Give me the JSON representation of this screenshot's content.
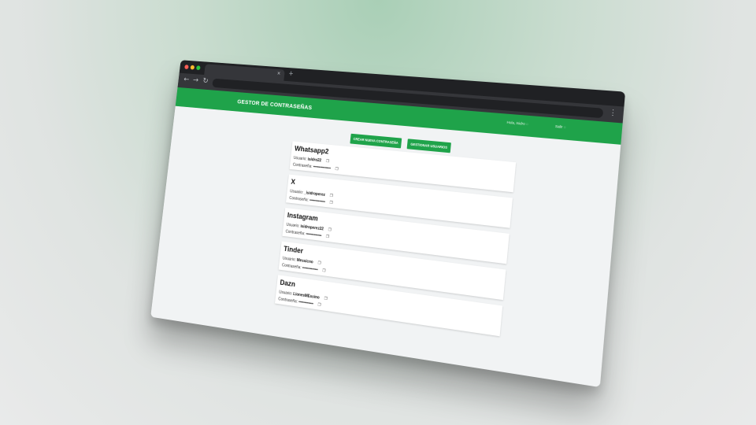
{
  "browser": {
    "tab_close": "×",
    "new_tab": "+",
    "back": "←",
    "forward": "→",
    "reload": "↻",
    "menu": "⋮"
  },
  "app": {
    "brand": "GESTOR DE CONTRASEÑAS",
    "greeting": "Hola, Isidro",
    "logout": "Salir",
    "create_button": "CREAR NUEVA CONTRASEÑA",
    "manage_button": "GESTIONAR USUARIOS"
  },
  "entries": [
    {
      "title": "Whatsapp2",
      "user_label": "Usuario:",
      "user": "isidro22",
      "pass_label": "Contraseña:",
      "pass": "••••••••••••••••••"
    },
    {
      "title": "X",
      "user_label": "Usuario:",
      "user": "_isidroperez",
      "pass_label": "Contraseña:",
      "pass": "••••••••••••••••"
    },
    {
      "title": "Instagram",
      "user_label": "Usuario:",
      "user": "isidroperez22",
      "pass_label": "Contraseña:",
      "pass": "••••••••••••••••"
    },
    {
      "title": "Tinder",
      "user_label": "Usuario:",
      "user": "Messicno",
      "pass_label": "Contraseña:",
      "pass": "••••••••••••••••"
    },
    {
      "title": "Dazn",
      "user_label": "Usuario:",
      "user": "LionesMEssino",
      "pass_label": "Contraseña:",
      "pass": "•••••••••••••••"
    }
  ],
  "colors": {
    "brand_green": "#1fa34a",
    "chrome_dark": "#202124",
    "page_bg": "#f1f3f4"
  },
  "icons": {
    "copy": "clipboard-icon",
    "header": "circle-icon"
  }
}
